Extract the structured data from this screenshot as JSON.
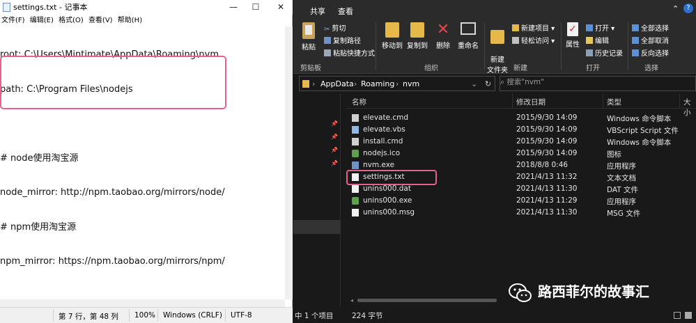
{
  "notepad": {
    "title": "settings.txt - 记事本",
    "menu": [
      "文件(F)",
      "编辑(E)",
      "格式(O)",
      "查看(V)",
      "帮助(H)"
    ],
    "lines": [
      "root: C:\\Users\\Mintimate\\AppData\\Roaming\\nvm",
      "path: C:\\Program Files\\nodejs",
      "",
      "# node使用淘宝源",
      "node_mirror: http://npm.taobao.org/mirrors/node/",
      "# npm使用淘宝源",
      "npm_mirror: https://npm.taobao.org/mirrors/npm/"
    ],
    "status": {
      "position": "第 7 行，第 48 列",
      "zoom": "100%",
      "line_ending": "Windows (CRLF)",
      "encoding": "UTF-8"
    },
    "window_buttons": [
      "—",
      "☐",
      "✕"
    ]
  },
  "explorer": {
    "tabs": [
      "共享",
      "查看"
    ],
    "ribbon": {
      "clipboard": {
        "label": "剪贴板",
        "paste": "粘贴",
        "cut": "剪切",
        "copy_path": "复制路径",
        "paste_shortcut": "粘贴快捷方式"
      },
      "organize": {
        "label": "组织",
        "move_to": "移动到",
        "copy_to": "复制到",
        "delete": "删除",
        "rename": "重命名"
      },
      "new": {
        "label": "新建",
        "new_folder": "新建\n文件夹",
        "new_item": "新建项目 ▾",
        "easy_access": "轻松访问 ▾"
      },
      "open": {
        "label": "打开",
        "properties": "属性",
        "open": "打开 ▾",
        "edit": "编辑",
        "history": "历史记录"
      },
      "select": {
        "label": "选择",
        "select_all": "全部选择",
        "select_none": "全部取消",
        "invert": "反向选择"
      }
    },
    "breadcrumb": [
      "AppData",
      "Roaming",
      "nvm"
    ],
    "search_placeholder": "搜索\"nvm\"",
    "columns": [
      "名称",
      "修改日期",
      "类型",
      "大小"
    ],
    "files": [
      {
        "name": "elevate.cmd",
        "date": "2015/9/30 14:09",
        "type": "Windows 命令脚本",
        "pinned": true
      },
      {
        "name": "elevate.vbs",
        "date": "2015/9/30 14:09",
        "type": "VBScript Script 文件",
        "pinned": true
      },
      {
        "name": "install.cmd",
        "date": "2015/9/30 14:09",
        "type": "Windows 命令脚本",
        "pinned": true
      },
      {
        "name": "nodejs.ico",
        "date": "2015/9/30 14:09",
        "type": "图标",
        "pinned": true
      },
      {
        "name": "nvm.exe",
        "date": "2018/8/8 0:46",
        "type": "应用程序",
        "pinned": false
      },
      {
        "name": "settings.txt",
        "date": "2021/4/13 11:32",
        "type": "文本文档",
        "pinned": false
      },
      {
        "name": "unins000.dat",
        "date": "2021/4/13 11:30",
        "type": "DAT 文件",
        "pinned": false
      },
      {
        "name": "unins000.exe",
        "date": "2021/4/13 11:29",
        "type": "应用程序",
        "pinned": false
      },
      {
        "name": "unins000.msg",
        "date": "2021/4/13 11:30",
        "type": "MSG 文件",
        "pinned": false
      }
    ],
    "status": {
      "count": "中 1 个项目",
      "size": "224 字节"
    }
  },
  "watermark": {
    "text": "路西菲尔的故事汇"
  },
  "colors": {
    "highlight": "#e8618c",
    "explorer_bg": "#191919",
    "ribbon_bg": "#2b2b2b"
  }
}
